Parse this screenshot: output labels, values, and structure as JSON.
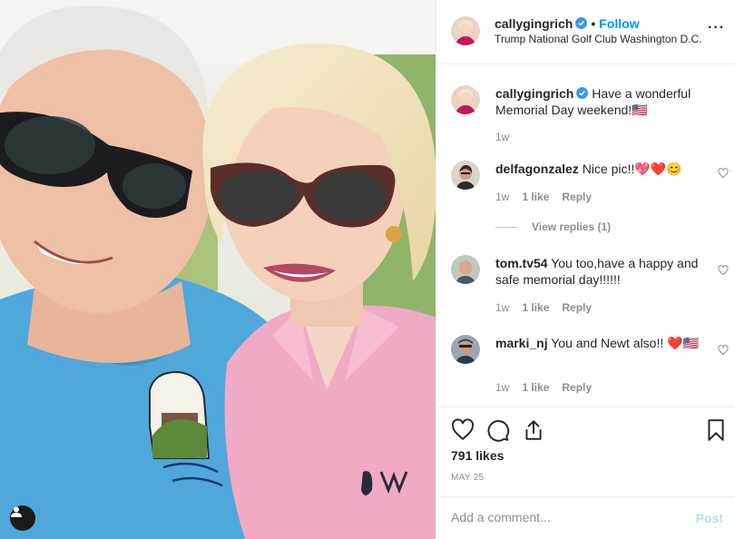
{
  "post": {
    "author": "callygingrich",
    "follow_label": "Follow",
    "location": "Trump National Golf Club Washington D.C.",
    "separator": "•",
    "more_label": "···",
    "user_tag_icon": "user-tag-icon"
  },
  "caption": {
    "username": "callygingrich",
    "text": "Have a wonderful Memorial Day weekend!🇺🇸",
    "time": "1w"
  },
  "comments": [
    {
      "username": "delfagonzalez",
      "text": "Nice pic!!💖❤️😊",
      "time": "1w",
      "likes": "1 like",
      "reply_label": "Reply"
    },
    {
      "username": "tom.tv54",
      "text": "You too,have a happy and safe memorial day!!!!!!",
      "time": "1w",
      "likes": "1 like",
      "reply_label": "Reply"
    },
    {
      "username": "marki_nj",
      "text": "You and Newt also!! ❤️🇺🇸",
      "time": "1w",
      "likes": "1 like",
      "reply_label": "Reply"
    }
  ],
  "view_replies": "View replies (1)",
  "stats": {
    "likes": "791 likes",
    "date": "MAY 25"
  },
  "composer": {
    "placeholder": "Add a comment...",
    "post_label": "Post"
  },
  "colors": {
    "accent": "#0095f6",
    "post_disabled": "#b2dffc",
    "muted": "#8e8e8e"
  }
}
